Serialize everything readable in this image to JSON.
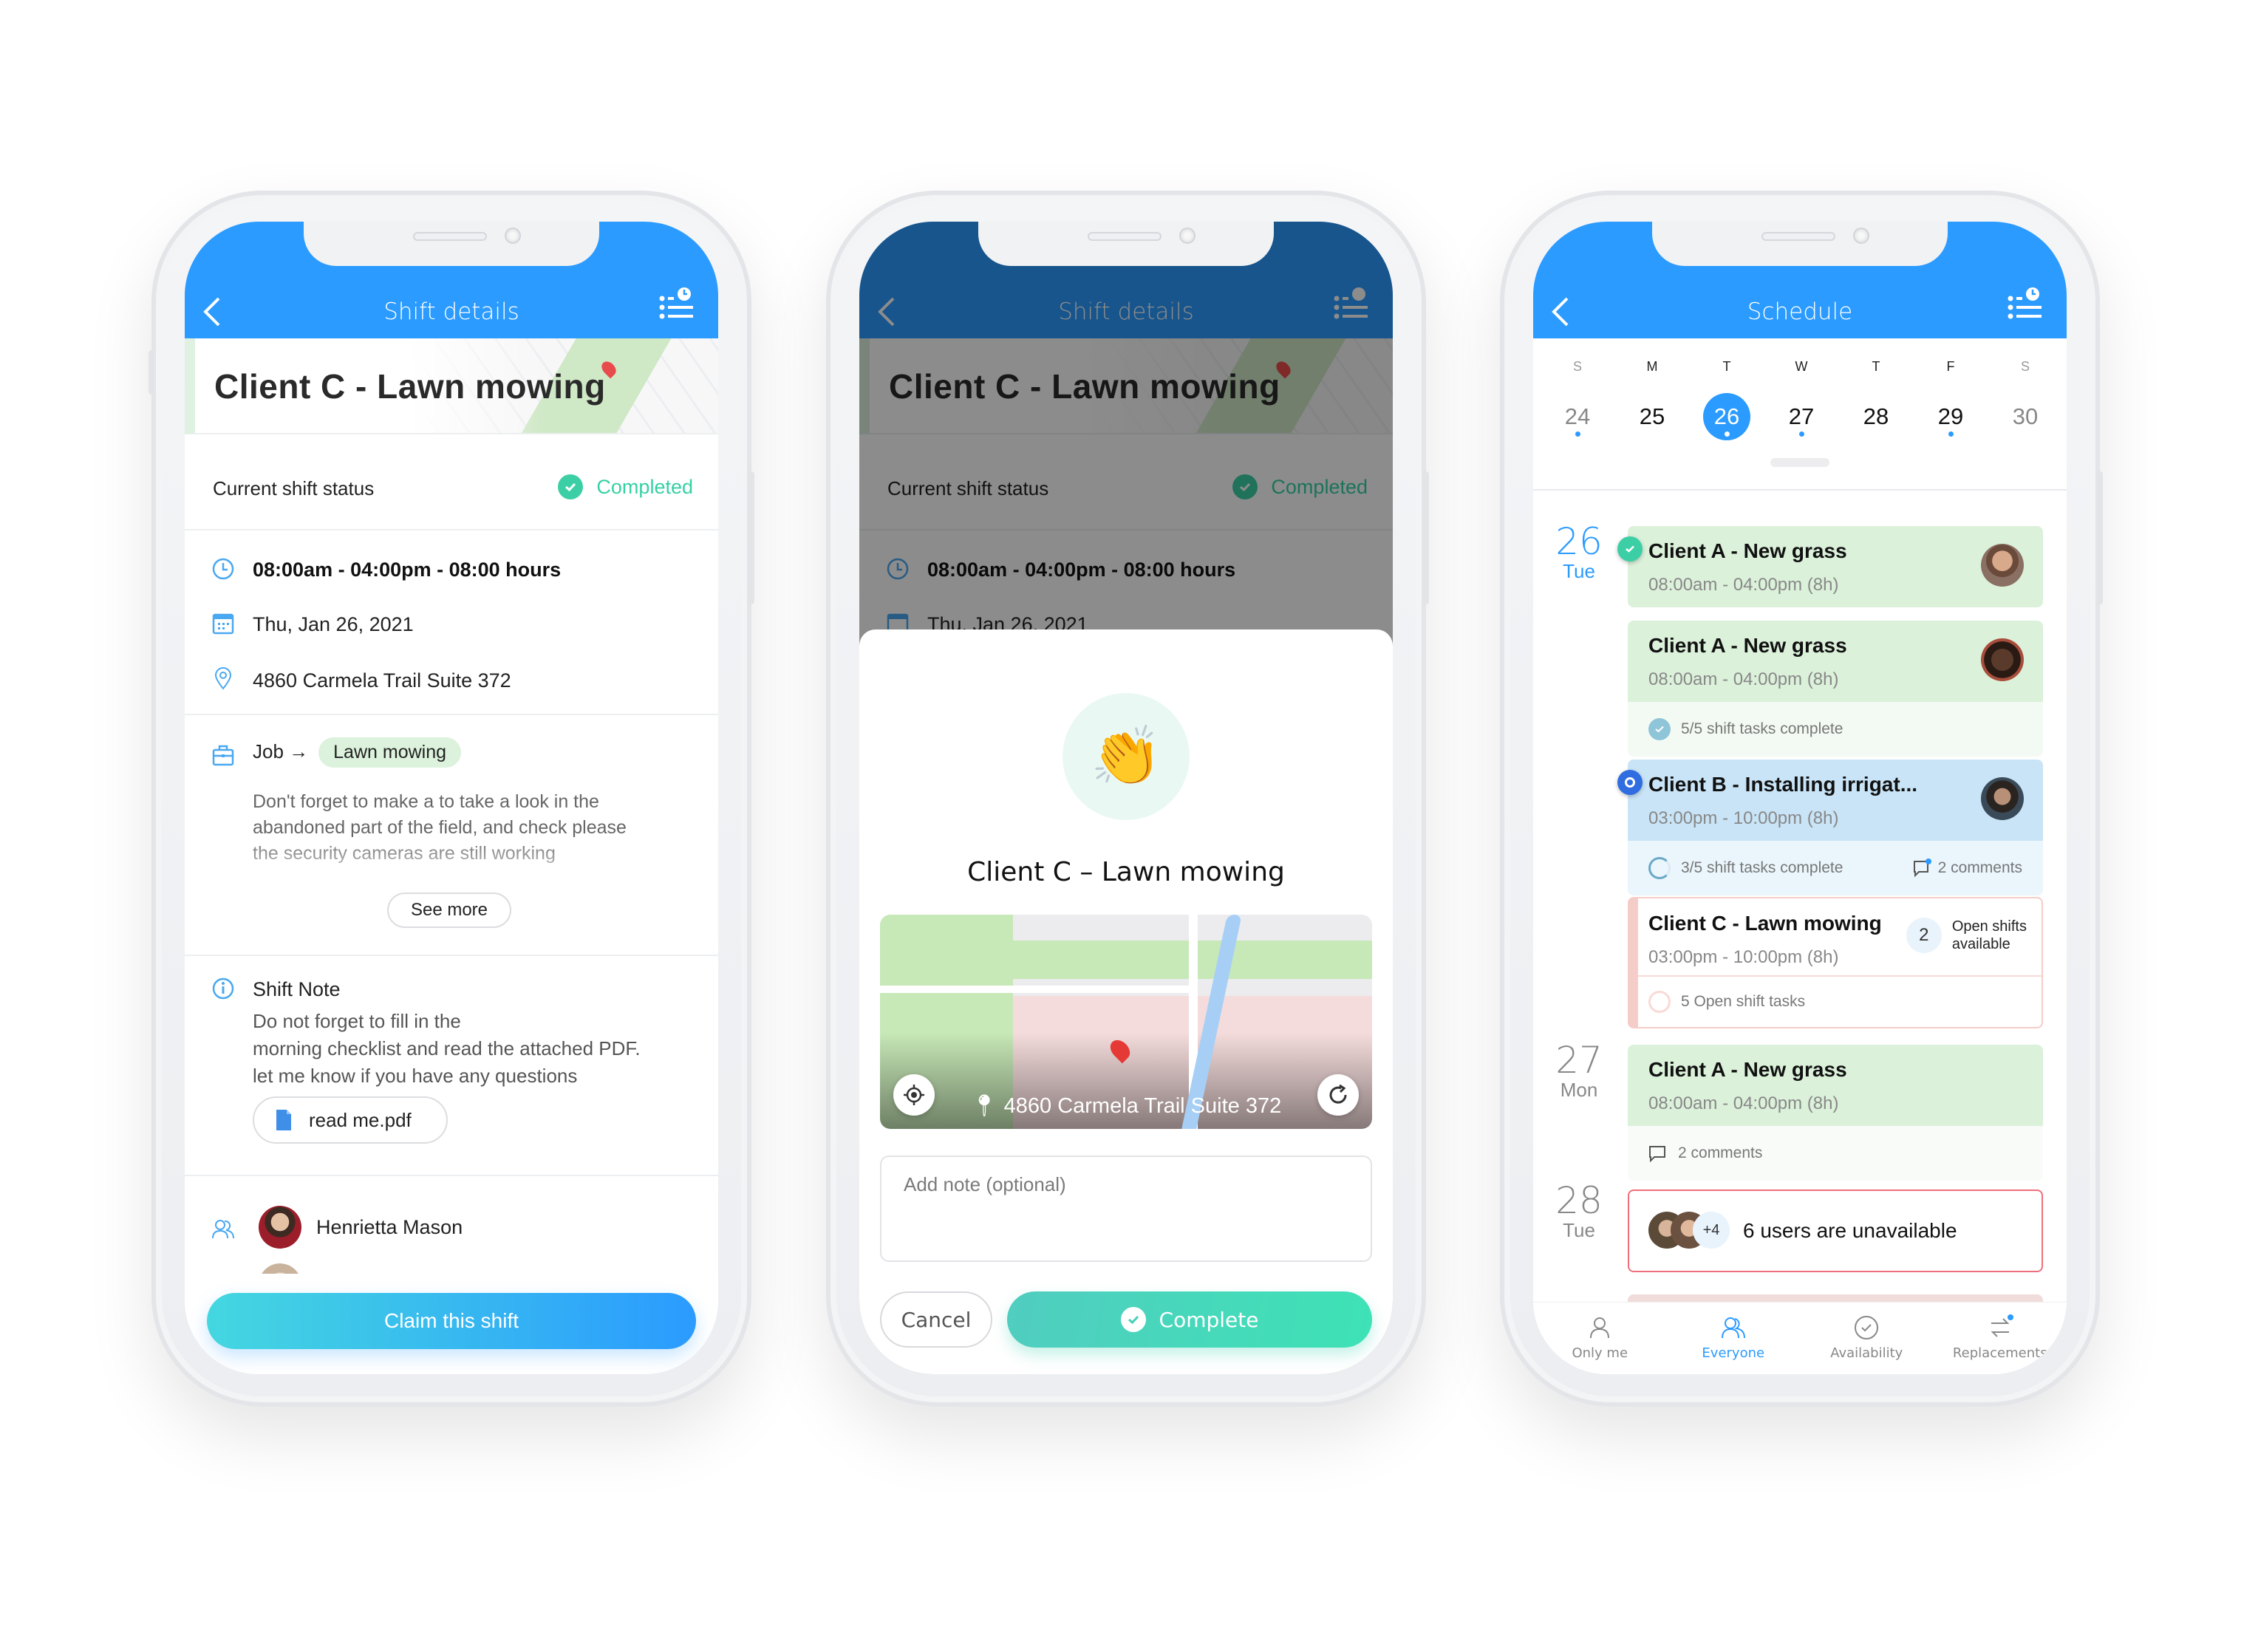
{
  "colors": {
    "primary": "#2b9bff",
    "success": "#3ccfa5",
    "open_shift": "#f5cdc8",
    "unavailable": "#ef6e7c"
  },
  "phone1": {
    "header": {
      "title": "Shift details",
      "back_icon": "chevron-left-icon",
      "menu_icon": "list-clock-icon"
    },
    "shift_title": "Client C - Lawn mowing",
    "status": {
      "label": "Current shift status",
      "value": "Completed"
    },
    "time": "08:00am - 04:00pm - 08:00 hours",
    "date": "Thu, Jan 26, 2021",
    "address": "4860 Carmela Trail Suite 372",
    "job": {
      "label": "Job →",
      "value": "Lawn mowing",
      "description": "Don't forget to make a to take a look in the abandoned part of the field, and check please the security cameras are still working",
      "see_more": "See more"
    },
    "shift_note": {
      "title": "Shift Note",
      "lines": [
        "Do not forget to fill in the",
        "morning checklist and read the attached PDF.",
        "let me know if you have any questions"
      ],
      "attachment": "read me.pdf"
    },
    "assignees": [
      {
        "name": "Henrietta Mason"
      }
    ],
    "claim_button": "Claim this shift"
  },
  "phone2": {
    "header": {
      "title": "Shift details"
    },
    "shift_title": "Client C - Lawn mowing",
    "status": {
      "label": "Current shift status",
      "value": "Completed"
    },
    "time": "08:00am - 04:00pm - 08:00 hours",
    "date": "Thu, Jan 26, 2021",
    "sheet": {
      "emoji": "👏",
      "title": "Client C – Lawn mowing",
      "map_address": "4860 Carmela Trail Suite 372",
      "note_placeholder": "Add note (optional)",
      "note_value": "",
      "cancel": "Cancel",
      "complete": "Complete"
    }
  },
  "phone3": {
    "header": {
      "title": "Schedule"
    },
    "week": {
      "days": [
        {
          "letter": "S",
          "num": "24",
          "dot": true,
          "weekend": true,
          "selected": false
        },
        {
          "letter": "M",
          "num": "25",
          "dot": false,
          "weekend": false,
          "selected": false
        },
        {
          "letter": "T",
          "num": "26",
          "dot": true,
          "weekend": false,
          "selected": true
        },
        {
          "letter": "W",
          "num": "27",
          "dot": true,
          "weekend": false,
          "selected": false
        },
        {
          "letter": "T",
          "num": "28",
          "dot": false,
          "weekend": false,
          "selected": false
        },
        {
          "letter": "F",
          "num": "29",
          "dot": true,
          "weekend": false,
          "selected": false
        },
        {
          "letter": "S",
          "num": "30",
          "dot": false,
          "weekend": true,
          "selected": false
        }
      ]
    },
    "days": [
      {
        "num": "26",
        "name": "Tue",
        "shifts": [
          {
            "title": "Client A - New grass",
            "time": "08:00am - 04:00pm (8h)",
            "status": "completed"
          },
          {
            "title": "Client A - New grass",
            "time": "08:00am - 04:00pm (8h)",
            "tasks": "5/5 shift tasks complete"
          },
          {
            "title": "Client B - Installing irrigat...",
            "time": "03:00pm - 10:00pm (8h)",
            "status": "in-progress",
            "tasks": "3/5 shift tasks complete",
            "comments": "2 comments"
          },
          {
            "title": "Client C - Lawn mowing",
            "time": "03:00pm - 10:00pm (8h)",
            "open_count": "2",
            "open_label_1": "Open shifts",
            "open_label_2": "available",
            "tasks": "5 Open shift tasks"
          }
        ]
      },
      {
        "num": "27",
        "name": "Mon",
        "shifts": [
          {
            "title": "Client A - New grass",
            "time": "08:00am - 04:00pm (8h)",
            "comments": "2 comments"
          }
        ]
      },
      {
        "num": "28",
        "name": "Tue",
        "unavailable": {
          "extra": "+4",
          "text": "6 users are unavailable"
        }
      }
    ],
    "tabs": [
      {
        "label": "Only me",
        "icon": "person-icon",
        "active": false
      },
      {
        "label": "Everyone",
        "icon": "people-icon",
        "active": true
      },
      {
        "label": "Availability",
        "icon": "check-circle-icon",
        "active": false
      },
      {
        "label": "Replacements",
        "icon": "swap-arrows-icon",
        "active": false,
        "badge": true
      }
    ]
  }
}
